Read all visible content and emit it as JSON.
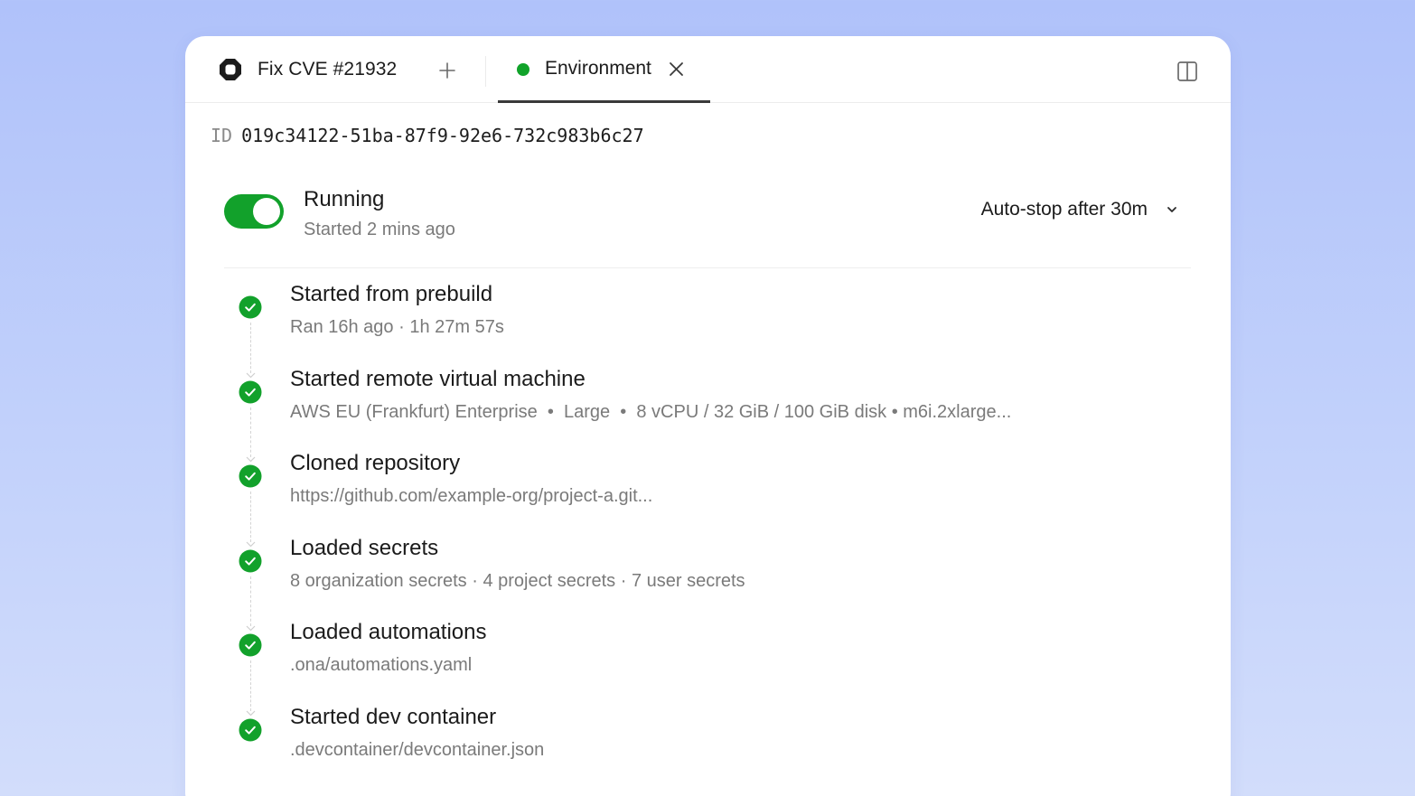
{
  "tabs": {
    "task": {
      "label": "Fix CVE #21932",
      "icon": "ona-logo-icon"
    },
    "new_tab_icon": "plus-icon",
    "environment": {
      "label": "Environment",
      "status_color": "#11a32a",
      "close_icon": "close-icon"
    },
    "panel_toggle_icon": "split-panel-icon"
  },
  "environment": {
    "id_prefix": "ID",
    "id": "019c34122-51ba-87f9-92e6-732c983b6c27",
    "status": "Running",
    "started": "Started 2 mins ago",
    "running": true,
    "auto_stop": "Auto-stop after 30m"
  },
  "colors": {
    "accent_green": "#12a12b",
    "background_top": "#b0c2fa",
    "background_bottom": "#d2ddfb"
  },
  "steps": [
    {
      "title": "Started from prebuild",
      "detail": "Ran 16h ago · 1h 27m 57s",
      "status": "done"
    },
    {
      "title": "Started remote virtual machine",
      "detail": "AWS EU (Frankfurt) Enterprise  •  Large  •  8 vCPU / 32 GiB / 100 GiB disk • m6i.2xlarge...",
      "status": "done"
    },
    {
      "title": "Cloned repository",
      "detail": "https://github.com/example-org/project-a.git...",
      "status": "done"
    },
    {
      "title": "Loaded secrets",
      "detail": "8 organization secrets · 4 project secrets · 7 user secrets",
      "status": "done"
    },
    {
      "title": "Loaded automations",
      "detail": ".ona/automations.yaml",
      "status": "done"
    },
    {
      "title": "Started dev container",
      "detail": ".devcontainer/devcontainer.json",
      "status": "done"
    }
  ]
}
